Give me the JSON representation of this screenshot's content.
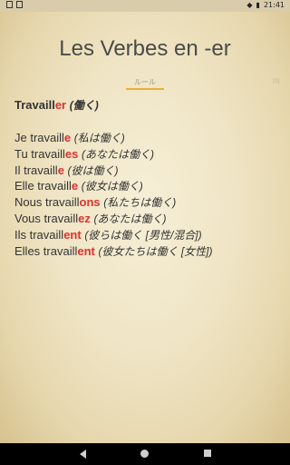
{
  "status": {
    "time": "21:41"
  },
  "screen": {
    "title": "Les Verbes en -er",
    "tabs": [
      {
        "label": "ルール"
      },
      {
        "label": "IN"
      }
    ]
  },
  "conjugation": {
    "heading": {
      "stem": "Travaill",
      "ending": "er",
      "translation": "(働く)"
    },
    "rows": [
      {
        "stem": "Je travaill",
        "ending": "e",
        "translation": "(私は働く)"
      },
      {
        "stem": "Tu travaill",
        "ending": "es",
        "translation": "(あなたは働く)"
      },
      {
        "stem": "Il travaill",
        "ending": "e",
        "translation": "(彼は働く)"
      },
      {
        "stem": "Elle travaill",
        "ending": "e",
        "translation": "(彼女は働く)"
      },
      {
        "stem": "Nous travaill",
        "ending": "ons",
        "translation": "(私たちは働く)"
      },
      {
        "stem": "Vous travaill",
        "ending": "ez",
        "translation": "(あなたは働く)"
      },
      {
        "stem": "Ils travaill",
        "ending": "ent",
        "translation": "(彼らは働く [男性/混合])"
      },
      {
        "stem": "Elles travaill",
        "ending": "ent",
        "translation": "(彼女たちは働く [女性])"
      }
    ]
  },
  "colors": {
    "ending": "#e0302e",
    "tab_underline": "#e7b13b"
  },
  "icons": {
    "status_left": [
      "notification-icon",
      "notification-icon"
    ],
    "status_right": [
      "wifi-icon",
      "battery-icon"
    ],
    "nav": [
      "back-icon",
      "home-icon",
      "recents-icon"
    ]
  }
}
